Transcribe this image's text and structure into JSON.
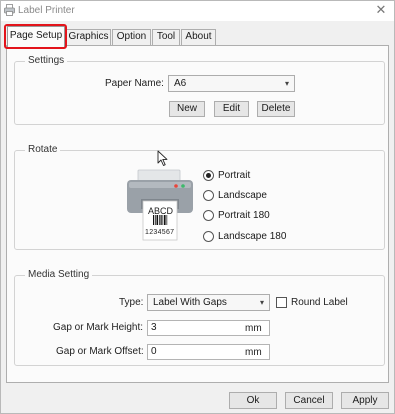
{
  "window": {
    "title": "Label Printer",
    "close_glyph": "✕"
  },
  "tabs": [
    {
      "label": "Page Setup",
      "active": true
    },
    {
      "label": "Graphics",
      "active": false
    },
    {
      "label": "Option",
      "active": false
    },
    {
      "label": "Tool",
      "active": false
    },
    {
      "label": "About",
      "active": false
    }
  ],
  "settings": {
    "title": "Settings",
    "paper_name_label": "Paper Name:",
    "paper_name_value": "A6",
    "new_label": "New",
    "edit_label": "Edit",
    "delete_label": "Delete"
  },
  "rotate": {
    "title": "Rotate",
    "label_text": "ABCD",
    "barcode_digits": "1234567",
    "options": [
      {
        "label": "Portrait",
        "checked": true
      },
      {
        "label": "Landscape",
        "checked": false
      },
      {
        "label": "Portrait 180",
        "checked": false
      },
      {
        "label": "Landscape 180",
        "checked": false
      }
    ]
  },
  "media": {
    "title": "Media Setting",
    "type_label": "Type:",
    "type_value": "Label With Gaps",
    "round_label": "Round Label",
    "round_checked": false,
    "gap_height_label": "Gap or Mark Height:",
    "gap_height_value": "3",
    "gap_offset_label": "Gap or Mark Offset:",
    "gap_offset_value": "0",
    "unit": "mm"
  },
  "footer": {
    "ok_label": "Ok",
    "cancel_label": "Cancel",
    "apply_label": "Apply"
  },
  "colors": {
    "highlight": "#e3141b",
    "printer_body": "#9aa1a8",
    "led_red": "#e8463c",
    "led_green": "#3cb96a"
  },
  "icons": [
    "printer-app-icon",
    "close-icon",
    "chevron-down-icon",
    "mouse-cursor-icon",
    "printer-illustration"
  ]
}
